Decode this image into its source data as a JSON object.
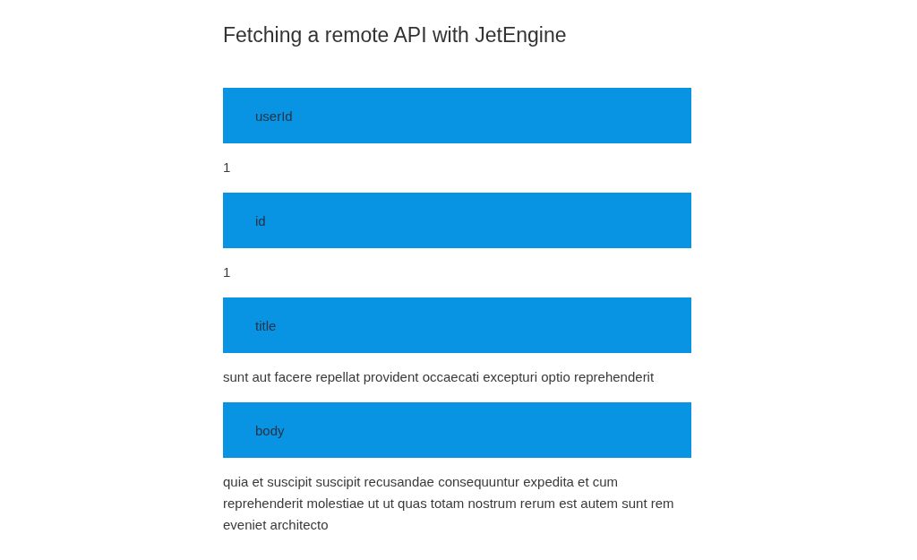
{
  "title": "Fetching a remote API with JetEngine",
  "fields": [
    {
      "label": "userId",
      "value": "1"
    },
    {
      "label": "id",
      "value": "1"
    },
    {
      "label": "title",
      "value": "sunt aut facere repellat provident occaecati excepturi optio reprehenderit"
    },
    {
      "label": "body",
      "value": "quia et suscipit suscipit recusandae consequuntur expedita et cum reprehenderit molestiae ut ut quas totam nostrum rerum est autem sunt rem eveniet architecto"
    }
  ]
}
